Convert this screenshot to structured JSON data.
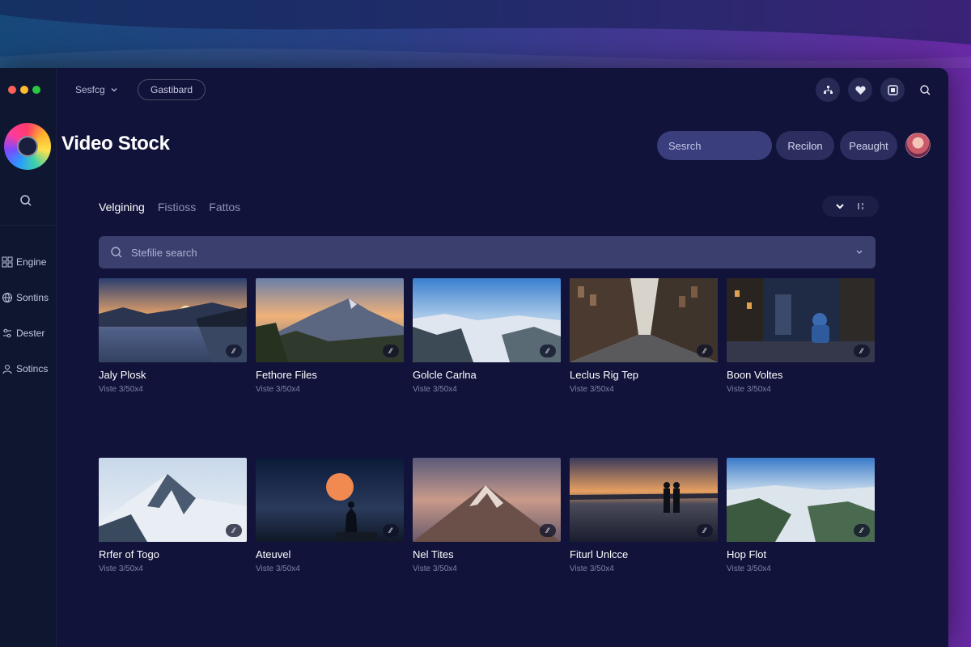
{
  "window": {
    "menu_label": "Sesfcg",
    "pill_label": "Gastibard"
  },
  "brand": {
    "title": "Video Stock"
  },
  "sidebar": {
    "items": [
      {
        "label": "Engine",
        "icon": "grid-icon"
      },
      {
        "label": "Sontins",
        "icon": "globe-icon"
      },
      {
        "label": "Dester",
        "icon": "sliders-icon"
      },
      {
        "label": "Sotincs",
        "icon": "user-icon"
      }
    ]
  },
  "header": {
    "search_label": "Sesrch",
    "btn1_label": "Recilon",
    "btn2_label": "Peaught"
  },
  "tabs": [
    {
      "label": "Velgining",
      "active": true
    },
    {
      "label": "Fistioss",
      "active": false
    },
    {
      "label": "Fattos",
      "active": false
    }
  ],
  "search": {
    "placeholder": "Stefilie search"
  },
  "videos": [
    {
      "title": "Jaly Plosk",
      "sub": "Viste 3/50x4",
      "scene": "sunset-lake"
    },
    {
      "title": "Fethore Files",
      "sub": "Viste 3/50x4",
      "scene": "mountain-valley"
    },
    {
      "title": "Golcle Carlna",
      "sub": "Viste 3/50x4",
      "scene": "aerial-snow"
    },
    {
      "title": "Leclus Rig Tep",
      "sub": "Viste 3/50x4",
      "scene": "city-street"
    },
    {
      "title": "Boon Voltes",
      "sub": "Viste 3/50x4",
      "scene": "city-night"
    },
    {
      "title": "Rrfer of Togo",
      "sub": "Viste 3/50x4",
      "scene": "snow-peak"
    },
    {
      "title": "Ateuvel",
      "sub": "Viste 3/50x4",
      "scene": "moon-silhouette"
    },
    {
      "title": "Nel Tites",
      "sub": "Viste 3/50x4",
      "scene": "lone-mountain"
    },
    {
      "title": "Fiturl Unlcce",
      "sub": "Viste 3/50x4",
      "scene": "sunset-couple"
    },
    {
      "title": "Hop Flot",
      "sub": "Viste 3/50x4",
      "scene": "alpine-aerial"
    }
  ]
}
